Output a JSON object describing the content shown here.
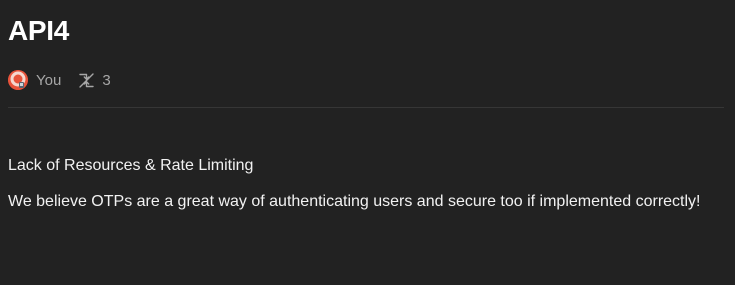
{
  "page": {
    "title": "API4"
  },
  "meta": {
    "author": "You",
    "avatar_icon": "avatar-lifebuoy",
    "fork_icon": "fork-arrows-icon",
    "fork_count": "3"
  },
  "content": {
    "heading": "Lack of Resources & Rate Limiting",
    "body": "We believe OTPs are a great way of authenticating users and secure too if implemented correctly!"
  },
  "colors": {
    "background": "#222222",
    "text": "#f2f2f2",
    "muted": "#a6a6a6",
    "avatar": "#e8533b"
  }
}
